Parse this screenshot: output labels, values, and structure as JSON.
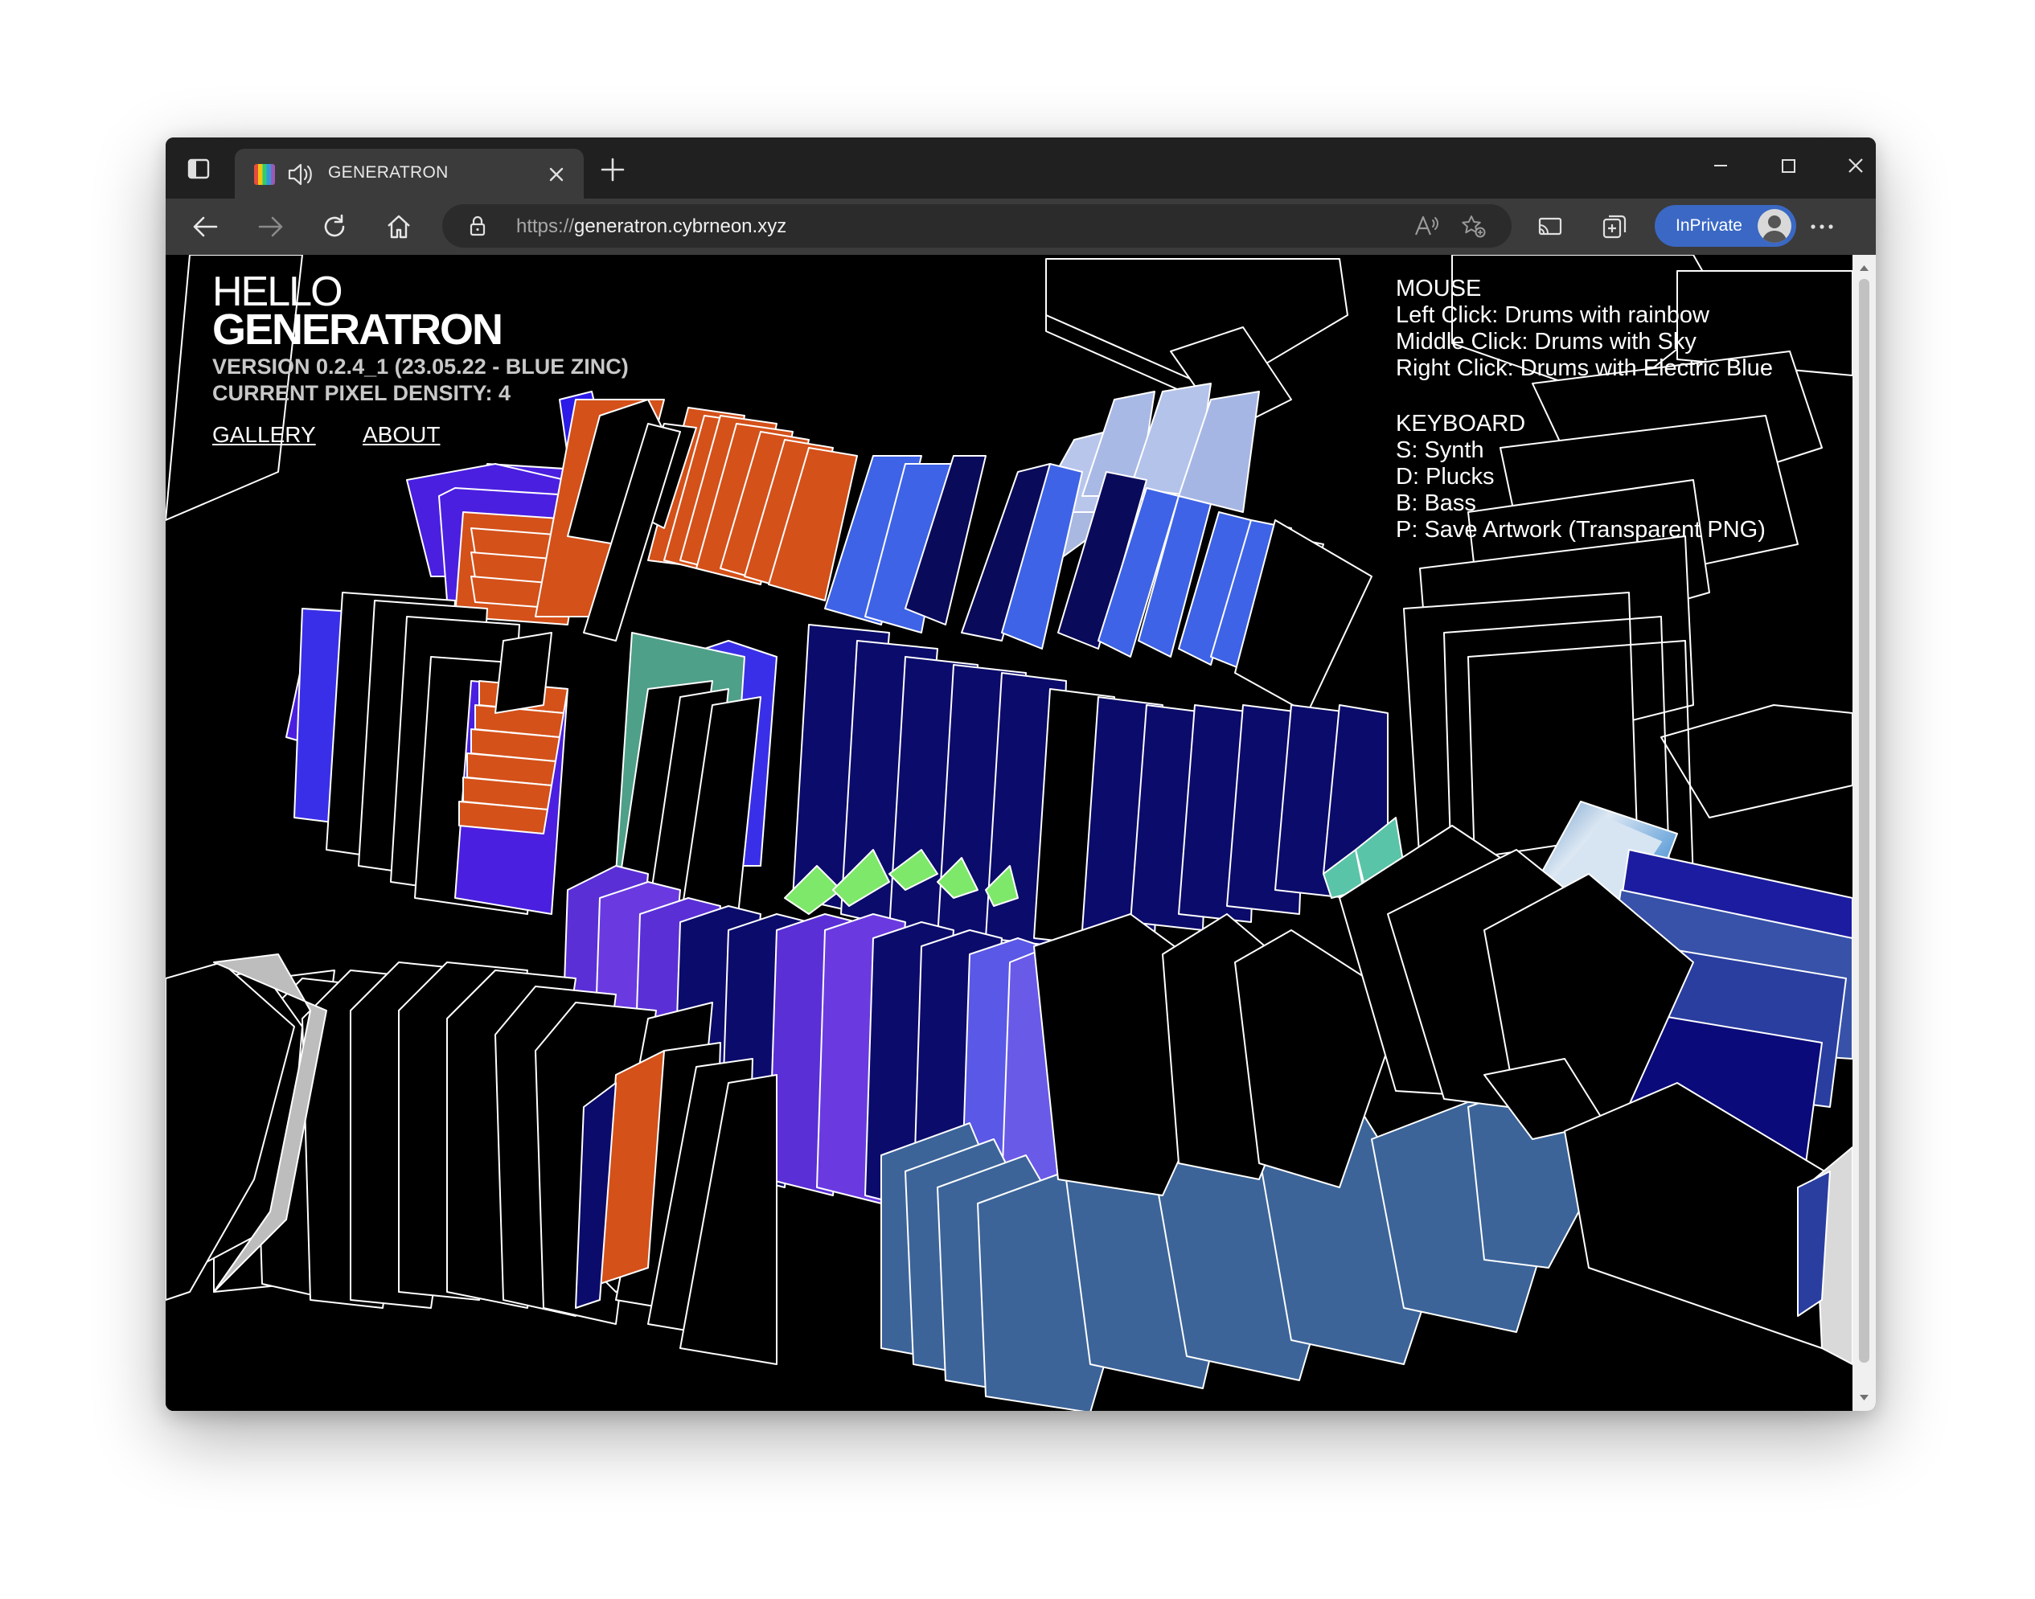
{
  "browser": {
    "tab_title": "GENERATRON",
    "url_scheme": "https://",
    "url_host": "generatron.cybrneon.xyz",
    "inprivate_label": "InPrivate"
  },
  "page": {
    "hello": "HELLO",
    "brand": "GENERATRON",
    "version": "VERSION 0.2.4_1 (23.05.22 - BLUE ZINC)",
    "density": "CURRENT PIXEL DENSITY: 4",
    "nav": {
      "gallery": "GALLERY",
      "about": "ABOUT"
    },
    "mouse_heading": "MOUSE",
    "mouse_items": [
      "Left Click: Drums with rainbow",
      "Middle Click: Drums with Sky",
      "Right Click: Drums with Electric Blue"
    ],
    "keyboard_heading": "KEYBOARD",
    "keyboard_items": [
      "S: Synth",
      "D: Plucks",
      "B: Bass",
      "P: Save Artwork (Transparent PNG)"
    ]
  },
  "colors": {
    "accent_inprivate": "#3a68c4",
    "art_orange": "#d4511a",
    "art_blue": "#3e63e6",
    "art_violet": "#4a1fe0",
    "art_navy": "#0c0c6e",
    "art_steel": "#3c6499",
    "art_green": "#7ee86a",
    "art_teal": "#5aa090"
  }
}
